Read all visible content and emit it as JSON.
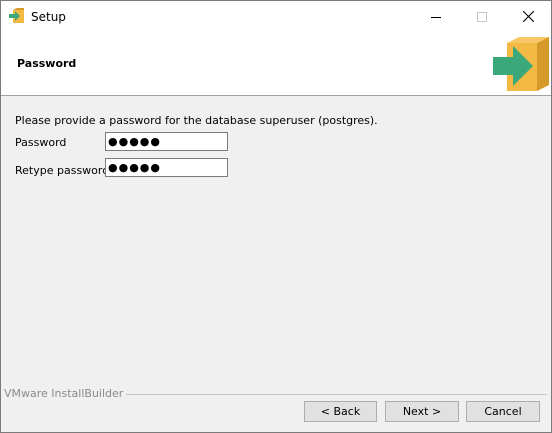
{
  "window": {
    "title": "Setup"
  },
  "header": {
    "title": "Password"
  },
  "form": {
    "instructions": "Please provide a password for the database superuser (postgres).",
    "password_label": "Password",
    "password_value": "●●●●●",
    "retype_label": "Retype password",
    "retype_value": "●●●●●"
  },
  "footer": {
    "brand": "VMware InstallBuilder",
    "back_label": "< Back",
    "next_label": "Next >",
    "cancel_label": "Cancel"
  },
  "icons": {
    "app": "box-arrow-icon",
    "logo": "box-arrow-icon",
    "minimize": "minimize-icon",
    "maximize": "maximize-icon",
    "close": "close-icon"
  },
  "colors": {
    "box": "#f4b942",
    "box_dark": "#d79a2a",
    "arrow": "#3aa87a"
  }
}
